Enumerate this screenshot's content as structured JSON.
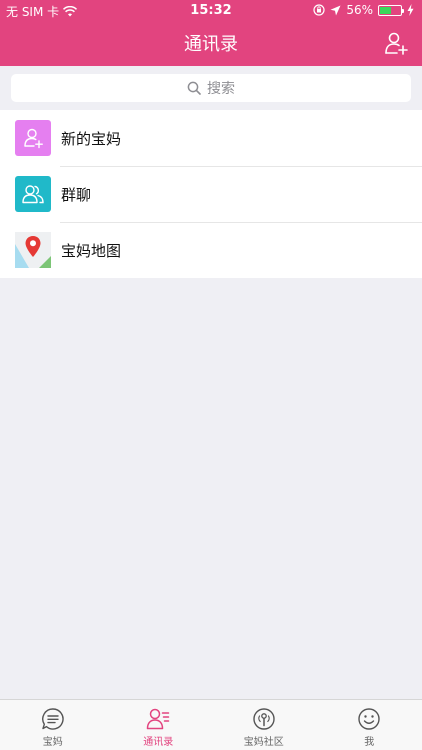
{
  "status": {
    "carrier": "无 SIM 卡",
    "time": "15:32",
    "battery": "56%",
    "battery_level": 0.56
  },
  "header": {
    "title": "通讯录",
    "add_icon": "add-contact-icon",
    "color": "#e2447f"
  },
  "search": {
    "placeholder": "搜索",
    "icon": "search-icon"
  },
  "list": {
    "items": [
      {
        "label": "新的宝妈",
        "icon": "add-user-icon",
        "color": "#e57ff0"
      },
      {
        "label": "群聊",
        "icon": "group-icon",
        "color": "#20b9c9"
      },
      {
        "label": "宝妈地图",
        "icon": "map-icon",
        "color": "#4caf50"
      }
    ]
  },
  "tabbar": {
    "tabs": [
      {
        "label": "宝妈",
        "icon": "chat-bubble-icon",
        "active": false
      },
      {
        "label": "通讯录",
        "icon": "contacts-icon",
        "active": true
      },
      {
        "label": "宝妈社区",
        "icon": "community-icon",
        "active": false
      },
      {
        "label": "我",
        "icon": "smiley-icon",
        "active": false
      }
    ],
    "active_color": "#e2447f"
  }
}
